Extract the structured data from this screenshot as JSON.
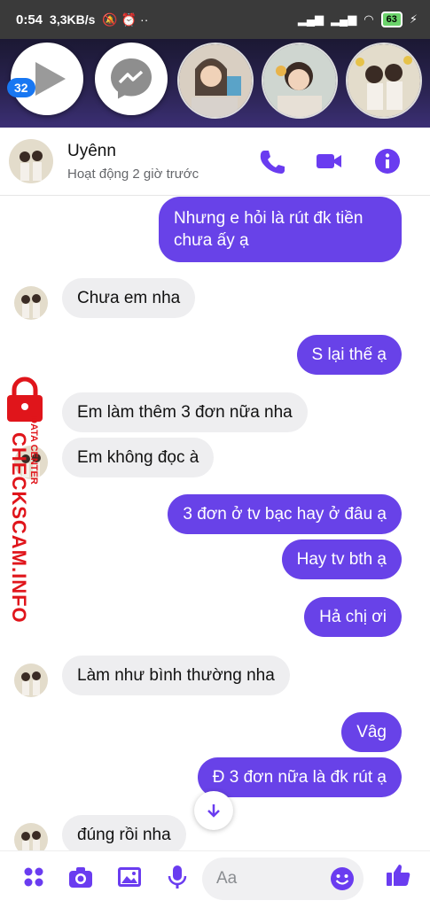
{
  "status_bar": {
    "time": "0:54",
    "speed": "3,3KB/s",
    "battery": "63"
  },
  "chat_heads": {
    "unread_count": "32"
  },
  "header": {
    "name": "Uyênn",
    "status": "Hoạt động 2 giờ trước"
  },
  "watermark": {
    "line1": "DATA CENTER",
    "line2": "CHECKSCAM.INFO"
  },
  "messages": [
    {
      "sender": "me",
      "text_line1": "Nhưng e hỏi là rút đk tiền",
      "text_line2": "chưa ấy ạ"
    },
    {
      "sender": "them",
      "text": "Chưa em nha"
    },
    {
      "sender": "me",
      "text": "S lại thế ạ"
    },
    {
      "sender": "them",
      "text": "Em làm thêm 3 đơn nữa nha"
    },
    {
      "sender": "them",
      "text": "Em không đọc à"
    },
    {
      "sender": "me",
      "text": "3 đơn ở tv bạc hay ở đâu ạ"
    },
    {
      "sender": "me",
      "text": "Hay tv bth ạ"
    },
    {
      "sender": "me",
      "text": "Hả chị ơi"
    },
    {
      "sender": "them",
      "text": "Làm như bình thường nha"
    },
    {
      "sender": "me",
      "text": "Vâg"
    },
    {
      "sender": "me",
      "text": "Đ 3 đơn nữa là đk rút ạ"
    },
    {
      "sender": "them",
      "text": "đúng rồi nha"
    }
  ],
  "composer": {
    "placeholder": "Aa"
  },
  "colors": {
    "outgoing_bubble": "#6842e8",
    "incoming_bubble": "#eeeef0",
    "accent": "#6a3cf0"
  },
  "icons": [
    "play-icon",
    "messenger-icon",
    "phone-icon",
    "video-icon",
    "info-icon",
    "scroll-down-icon",
    "apps-icon",
    "camera-icon",
    "gallery-icon",
    "microphone-icon",
    "emoji-icon",
    "like-icon"
  ]
}
